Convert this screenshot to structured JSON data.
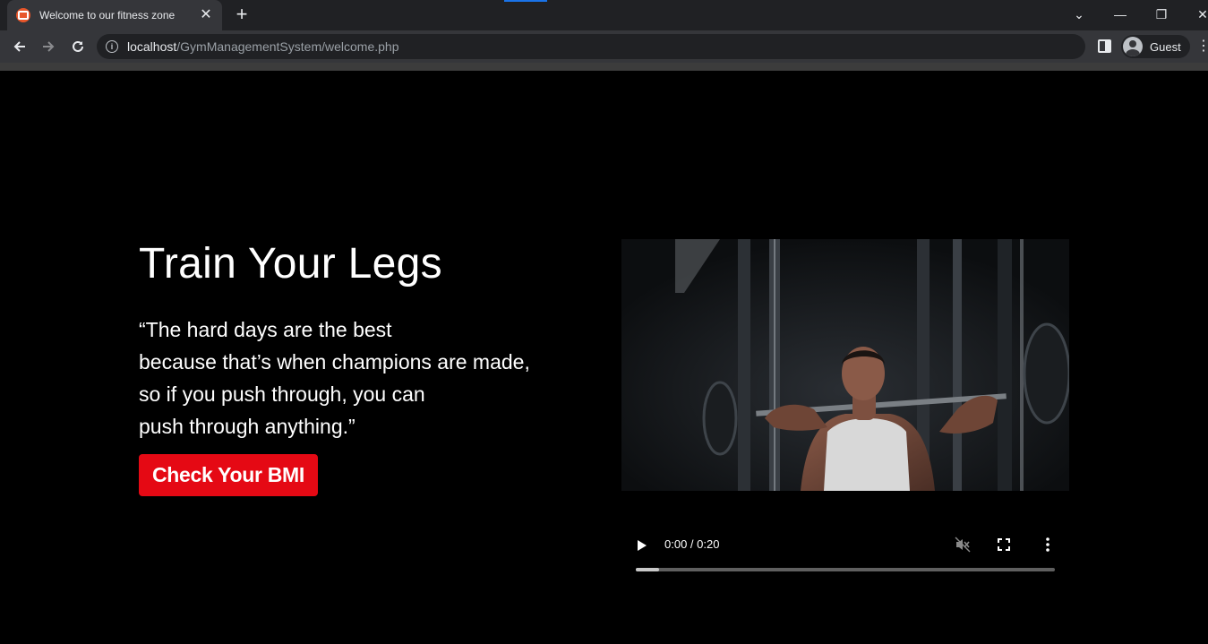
{
  "browser": {
    "tab_title": "Welcome to our fitness zone",
    "tab_close": "✕",
    "new_tab": "+",
    "url_host": "localhost",
    "url_path": "/GymManagementSystem/welcome.php",
    "profile_label": "Guest",
    "window_controls": [
      "⌄",
      "—",
      "❐",
      "✕"
    ],
    "icons": [
      "favicon-icon",
      "back-arrow-icon",
      "forward-arrow-icon",
      "reload-icon",
      "info-icon",
      "side-panel-icon",
      "profile-avatar-icon",
      "menu-dots-icon"
    ]
  },
  "hero": {
    "title": "Train Your Legs",
    "quote_lines": [
      "“The hard days are the best",
      "because that’s when champions are made,",
      "so if you push through, you can",
      "push through anything.”"
    ],
    "cta_label": "Check Your BMI",
    "cta_color": "#e50914"
  },
  "video": {
    "poster_description_icon": "video-poster",
    "time_label": "0:00 / 0:20",
    "progress_fraction": 0.055,
    "icons": [
      "play-icon",
      "mute-icon",
      "fullscreen-icon",
      "more-options-icon"
    ]
  }
}
